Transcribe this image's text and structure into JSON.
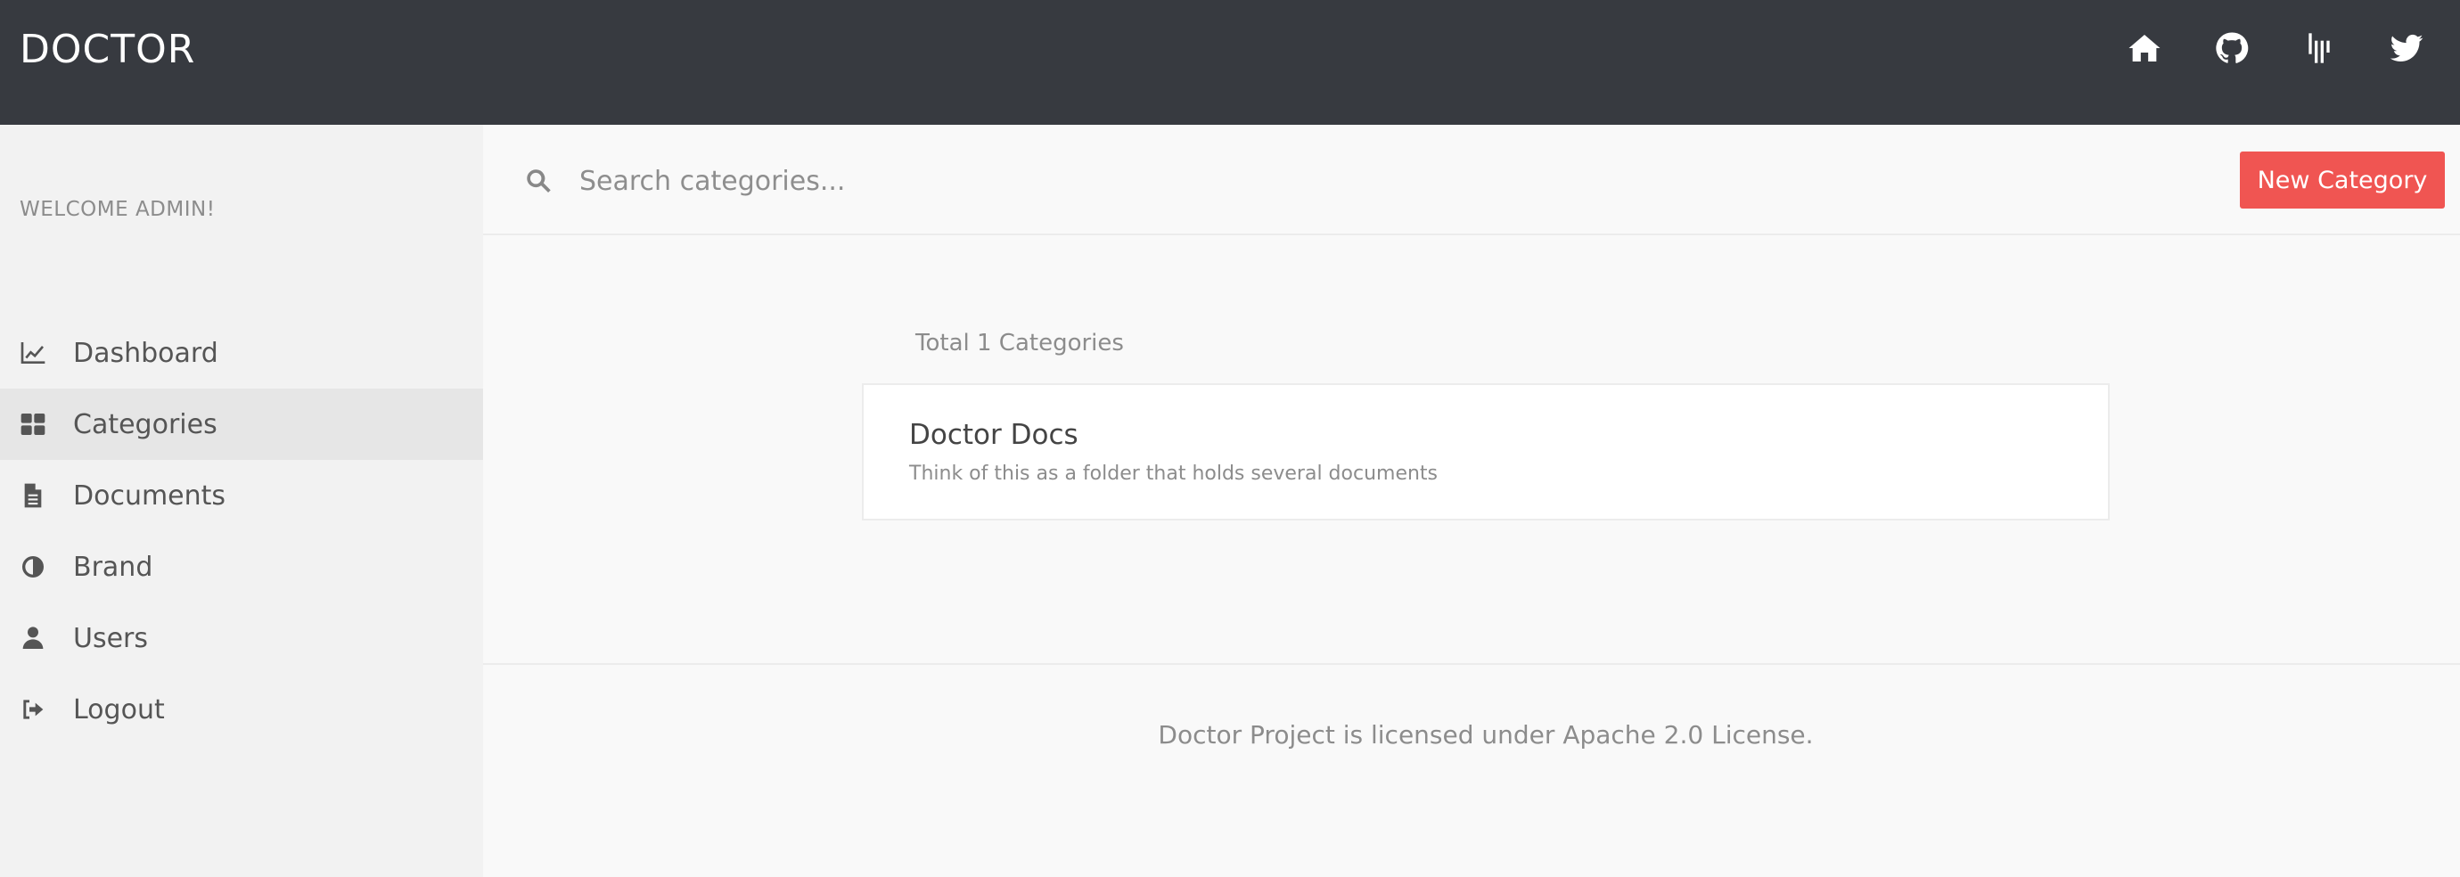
{
  "header": {
    "brand": "DOCTOR",
    "icons": [
      "home-icon",
      "github-icon",
      "gitter-icon",
      "twitter-icon"
    ]
  },
  "sidebar": {
    "welcome": "WELCOME ADMIN!",
    "items": [
      {
        "label": "Dashboard",
        "icon": "chart-line-icon",
        "active": false
      },
      {
        "label": "Categories",
        "icon": "grid-icon",
        "active": true
      },
      {
        "label": "Documents",
        "icon": "document-icon",
        "active": false
      },
      {
        "label": "Brand",
        "icon": "contrast-icon",
        "active": false
      },
      {
        "label": "Users",
        "icon": "user-icon",
        "active": false
      },
      {
        "label": "Logout",
        "icon": "logout-icon",
        "active": false
      }
    ]
  },
  "search": {
    "placeholder": "Search categories...",
    "value": ""
  },
  "actions": {
    "new_category": "New Category"
  },
  "main": {
    "total_text": "Total 1 Categories",
    "categories": [
      {
        "title": "Doctor Docs",
        "description": "Think of this as a folder that holds several documents"
      }
    ]
  },
  "footer": {
    "text": "Doctor Project is licensed under Apache 2.0 License."
  },
  "colors": {
    "topbar": "#373a40",
    "accent": "#f05552",
    "sidebar": "#f2f2f2",
    "active_item": "#e6e6e6"
  }
}
